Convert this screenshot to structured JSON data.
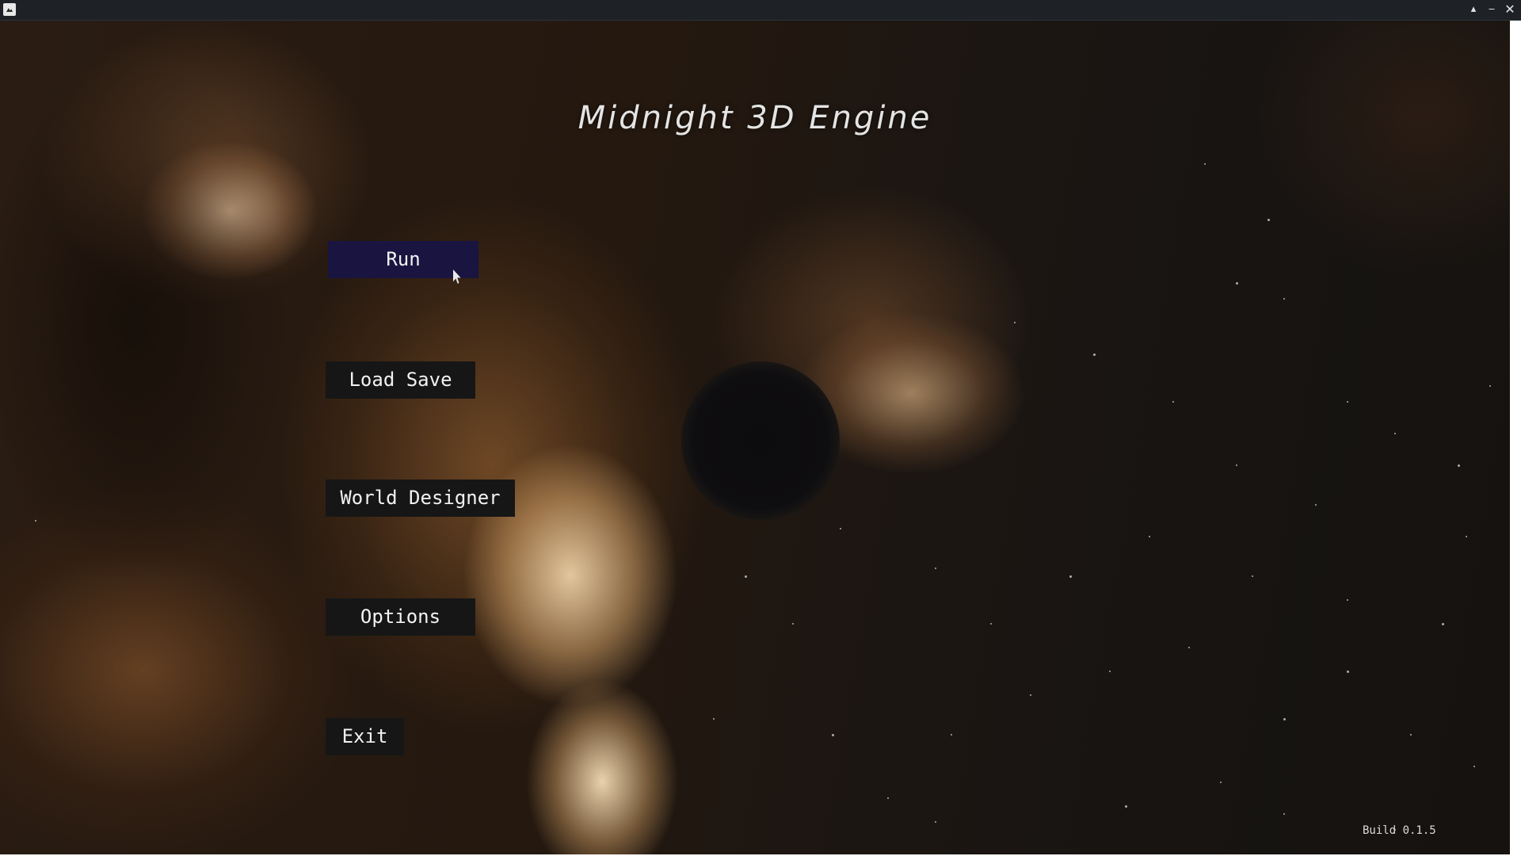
{
  "window": {
    "icon": "image-app-icon",
    "controls": {
      "maximize": "▴",
      "minimize": "‒",
      "close": "✕"
    }
  },
  "main_menu": {
    "title": "Midnight 3D Engine",
    "items": [
      {
        "label": "Run",
        "state": "highlighted"
      },
      {
        "label": "Load Save"
      },
      {
        "label": "World Designer"
      },
      {
        "label": "Options"
      },
      {
        "label": "Exit"
      }
    ],
    "build": "Build 0.1.5"
  },
  "colors": {
    "button_bg": "#161616",
    "button_active_bg": "#1a1440",
    "text": "#f2f2f2"
  }
}
